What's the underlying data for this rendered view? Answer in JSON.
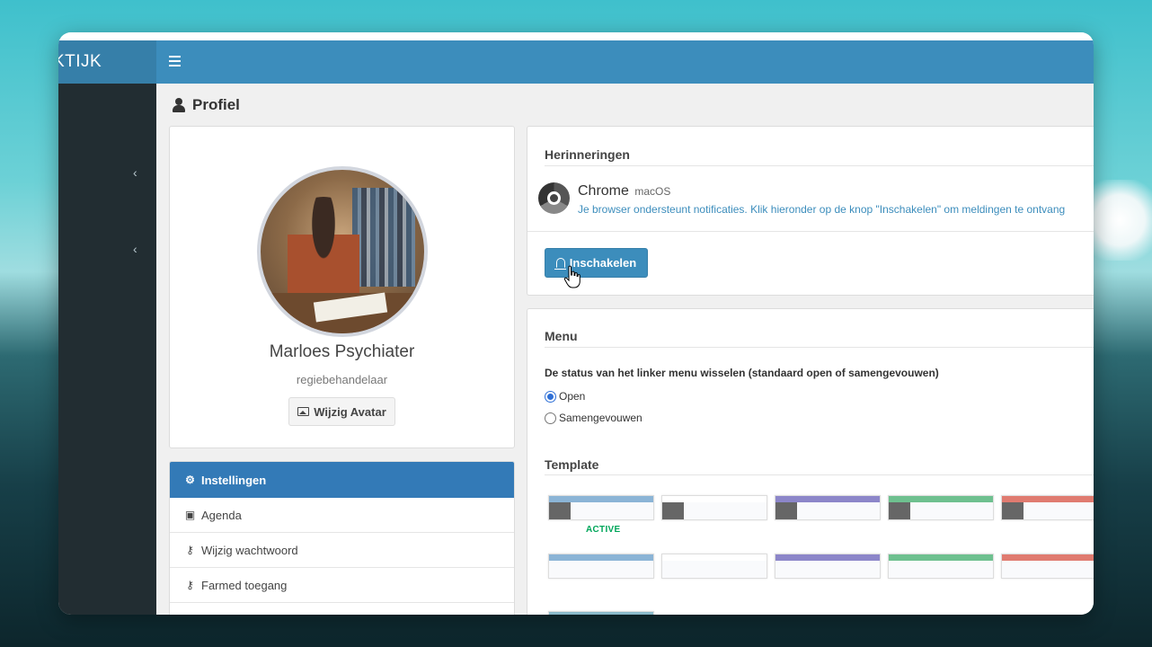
{
  "app": {
    "brand_text": "KTIJK"
  },
  "page": {
    "title": "Profiel"
  },
  "profile": {
    "name": "Marloes Psychiater",
    "role": "regiebehandelaar",
    "change_avatar_label": "Wijzig Avatar"
  },
  "side_menu": {
    "items": [
      {
        "label": "Instellingen",
        "icon": "gears-icon",
        "active": true
      },
      {
        "label": "Agenda",
        "icon": "calendar-check-icon",
        "active": false
      },
      {
        "label": "Wijzig wachtwoord",
        "icon": "key-icon",
        "active": false
      },
      {
        "label": "Farmed toegang",
        "icon": "key-icon",
        "active": false
      }
    ]
  },
  "reminders": {
    "title": "Herinneringen",
    "browser_name": "Chrome",
    "os_name": "macOS",
    "description": "Je browser ondersteunt notificaties. Klik hieronder op de knop \"Inschakelen\" om meldingen te ontvang",
    "enable_label": "Inschakelen"
  },
  "menu_settings": {
    "title": "Menu",
    "description": "De status van het linker menu wisselen (standaard open of samengevouwen)",
    "options": [
      {
        "label": "Open",
        "selected": true
      },
      {
        "label": "Samengevouwen",
        "selected": false
      }
    ]
  },
  "template": {
    "title": "Template",
    "active_label": "ACTIVE",
    "skins_row1": [
      {
        "color": "#8bb4d6",
        "side": "#666666",
        "active": true
      },
      {
        "color": "#ffffff",
        "side": "#666666",
        "active": false
      },
      {
        "color": "#8c86c9",
        "side": "#666666",
        "active": false
      },
      {
        "color": "#6ec08f",
        "side": "#666666",
        "active": false
      },
      {
        "color": "#e07b70",
        "side": "#666666",
        "active": false
      }
    ],
    "skins_row2": [
      {
        "color": "#8bb4d6",
        "side": "#f9fafc"
      },
      {
        "color": "#ffffff",
        "side": "#f9fafc"
      },
      {
        "color": "#8c86c9",
        "side": "#f9fafc"
      },
      {
        "color": "#6ec08f",
        "side": "#f9fafc"
      },
      {
        "color": "#e07b70",
        "side": "#f9fafc"
      }
    ]
  },
  "colors": {
    "navbar": "#3c8dbc",
    "brand": "#367fa9",
    "sidebar": "#222d32",
    "active_menu": "#337ab7",
    "link": "#3c8dbc",
    "active_text": "#00a65a"
  }
}
